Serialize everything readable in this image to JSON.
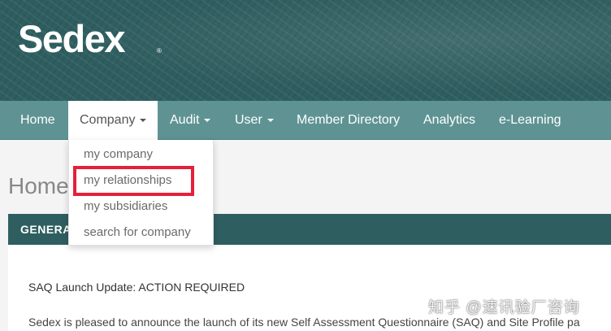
{
  "brand": {
    "logo_text": "Sedex",
    "registered_mark": "®",
    "logo_dot_color": "#d6164f",
    "banner_color": "#2f5e60"
  },
  "navbar": {
    "color": "#5f9393",
    "items": [
      {
        "label": "Home",
        "has_caret": false
      },
      {
        "label": "Company",
        "has_caret": true,
        "active": true
      },
      {
        "label": "Audit",
        "has_caret": true
      },
      {
        "label": "User",
        "has_caret": true
      },
      {
        "label": "Member Directory",
        "has_caret": false
      },
      {
        "label": "Analytics",
        "has_caret": false
      },
      {
        "label": "e-Learning",
        "has_caret": false
      }
    ]
  },
  "company_menu": {
    "items": [
      {
        "label": "my company"
      },
      {
        "label": "my relationships",
        "highlighted": true
      },
      {
        "label": "my subsidiaries"
      },
      {
        "label": "search for company"
      }
    ],
    "highlight_color": "#e5203a"
  },
  "page": {
    "title": "Home",
    "panel_header": "GENERA",
    "notice_title": "SAQ Launch Update: ACTION REQUIRED",
    "notice_text": "Sedex is pleased to announce the launch of its new Self Assessment Questionnaire (SAQ) and Site Profile pa"
  },
  "watermark": "知乎 @速讯验厂咨询"
}
